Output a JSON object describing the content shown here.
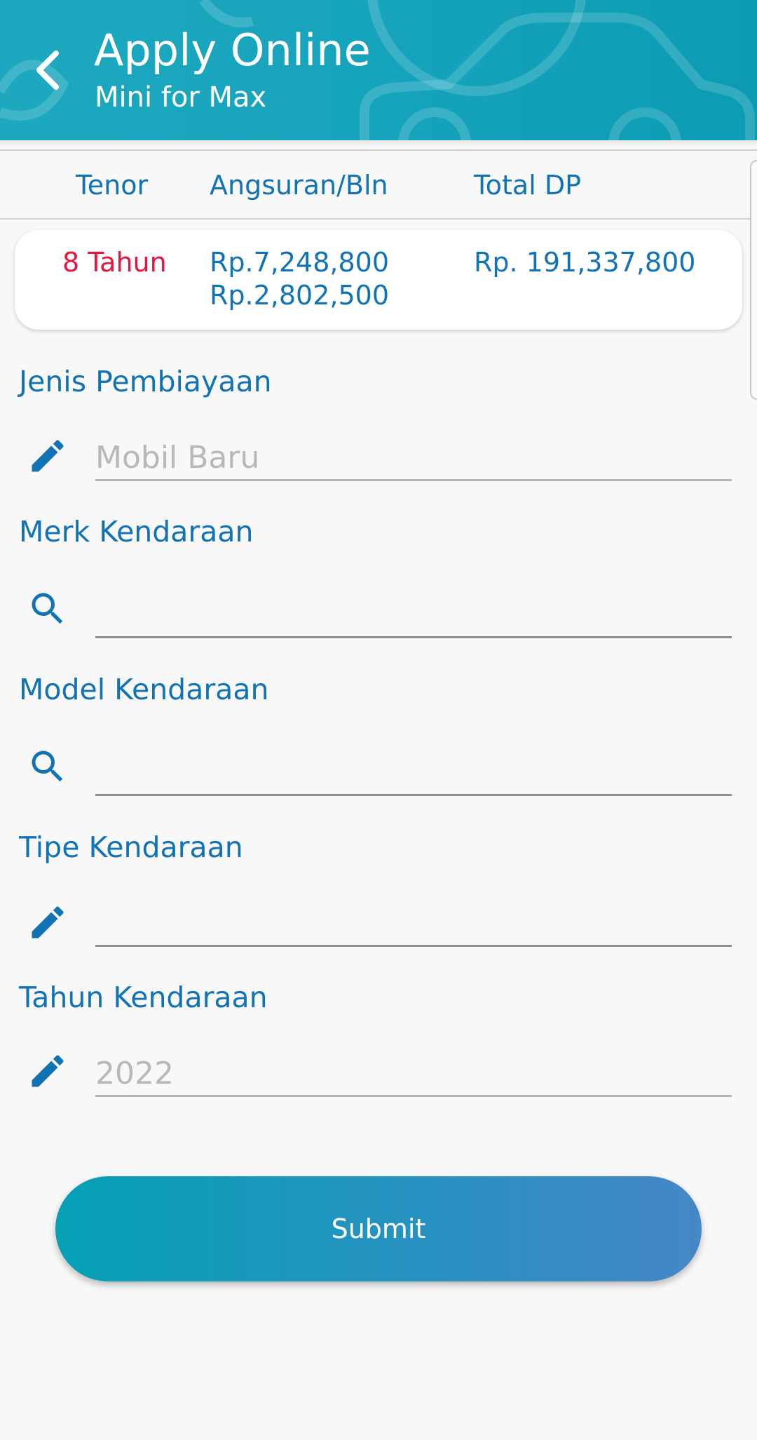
{
  "header": {
    "title": "Apply Online",
    "subtitle": "Mini for Max",
    "back_icon": "chevron-left-icon"
  },
  "table": {
    "columns": [
      "Tenor",
      "Angsuran/Bln",
      "Total DP"
    ],
    "row": {
      "tenor": "8 Tahun",
      "angsuran_1": "Rp.7,248,800",
      "angsuran_2": "Rp.2,802,500",
      "total_dp": "Rp. 191,337,800"
    }
  },
  "form": {
    "jenis": {
      "label": "Jenis Pembiayaan",
      "placeholder": "Mobil Baru",
      "value": "",
      "icon": "pencil-icon"
    },
    "merk": {
      "label": "Merk Kendaraan",
      "placeholder": "",
      "value": "",
      "icon": "search-icon"
    },
    "model": {
      "label": "Model Kendaraan",
      "placeholder": "",
      "value": "",
      "icon": "search-icon"
    },
    "tipe": {
      "label": "Tipe Kendaraan",
      "placeholder": "",
      "value": "",
      "icon": "pencil-icon"
    },
    "tahun": {
      "label": "Tahun Kendaraan",
      "placeholder": "2022",
      "value": "",
      "icon": "pencil-icon"
    }
  },
  "submit_label": "Submit",
  "colors": {
    "primary": "#1173b3",
    "header": "#15a3bb",
    "accent_red": "#e5173f",
    "button_start": "#05a0b5",
    "button_end": "#4687c6"
  }
}
